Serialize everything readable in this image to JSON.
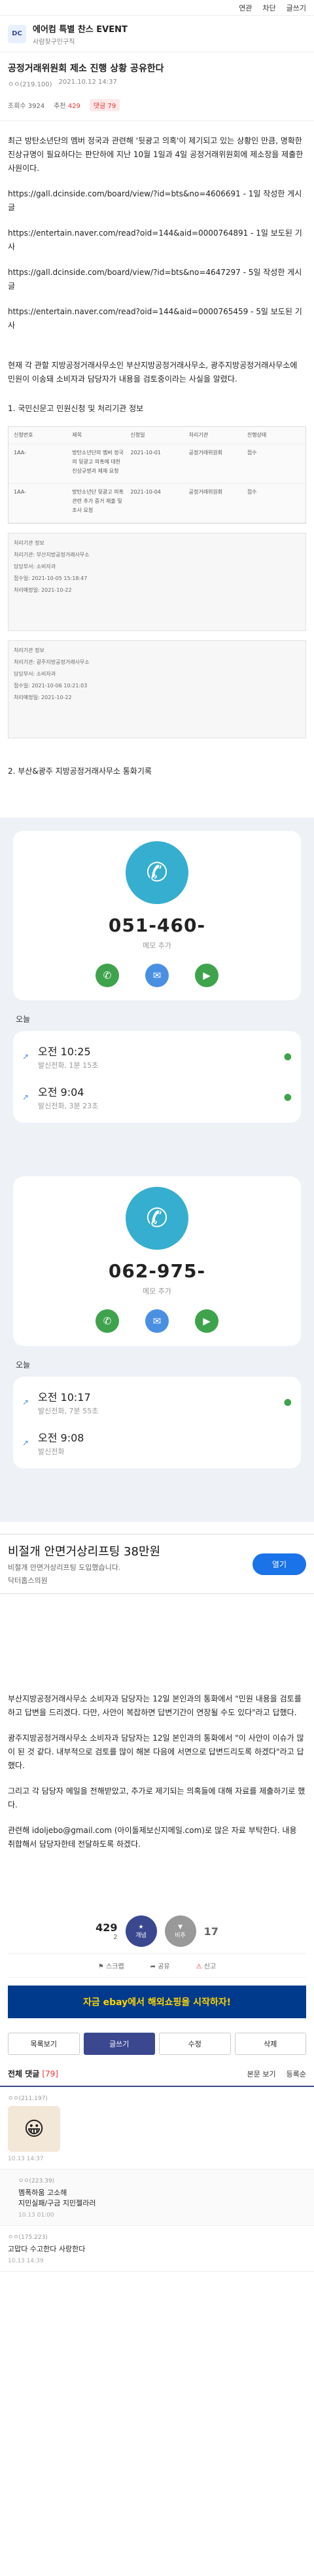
{
  "topbar": {
    "login": "연관",
    "top": "차단",
    "up": "글쓰기"
  },
  "board": {
    "title": "에어컴 특별 찬스 EVENT",
    "sub": "사람찾구인구직",
    "logo_text": "DC"
  },
  "post": {
    "title": "공정거래위원회 제소 진행 상황 공유한다",
    "author": "ㅇㅇ(219.100)",
    "date": "2021.10.12 14:37",
    "views": "조회수 3924",
    "likes_label": "추천",
    "likes": "429",
    "comments": "댓글 79"
  },
  "body": {
    "p1": "최근 방탄소년단의 멤버 정국과 관련해 '뒷광고 의혹'이 제기되고 있는 상황인 만큼, 명확한 진상규명이 필요하다는 판단하에 지난 10월 1일과 4일 공정거래위원회에 제소장을 제출한 사원이다.",
    "link1": "https://gall.dcinside.com/board/view/?id=bts&no=4606691 - 1일 작성한 게시글",
    "link2": "https://entertain.naver.com/read?oid=144&aid=0000764891 - 1일 보도된 기사",
    "link3": "https://gall.dcinside.com/board/view/?id=bts&no=4647297 - 5일 작성한 게시글",
    "link4": "https://entertain.naver.com/read?oid=144&aid=0000765459 - 5일 보도된 기사",
    "p2": "현재 각 관할 지방공정거래사무소인 부산지방공정거래사무소, 광주지방공정거래사무소에 민원이 이송돼 소비자과 담당자가 내용을 검토중이라는 사실을 알렸다.",
    "h1": "1. 국민신문고 민원신청 및 처리기관 정보",
    "h2": "2. 부산&광주 지방공정거래사무소 통화기록",
    "p3": "부산지방공정거래사무소 소비자과 담당자는 12일 본인과의 통화에서 \"민원 내용을 검토를 하고 답변을 드리겠다. 다만, 사안이 복잡하면 답변기간이 연장될 수도 있다\"라고 답했다.",
    "p4": "광주지방공정거래사무소 소비자과 담당자는 12일 본인과의 통화에서 \"이 사안이 이슈가 많이 된 것 같다. 내부적으로 검토를 많이 해본 다음에 서면으로 답변드리도록 하겠다\"라고 답했다.",
    "p5": "그리고 각 담당자 메일을 전해받았고, 추가로 제기되는 의혹들에 대해 자료를 제출하기로 했다.",
    "p6": "관련해 idoljebo@gmail.com (아이돌제보신지메일.com)로 많은 자료 부탁한다. 내용 취합해서 담당자한테 전달하도록 하겠다."
  },
  "doc": {
    "headers": [
      "신청번호",
      "제목",
      "신청일",
      "처리기관",
      "진행상태"
    ],
    "rows": [
      [
        "1AA-",
        "방탄소년단의 멤버 정국의 뒷광고 의혹에 대한 진상규명과 제재 요청",
        "2021-10-01",
        "공정거래위원회",
        "접수"
      ],
      [
        "1AA-",
        "방탄소년단 뒷광고 의혹 관련 추가 증거 제출 및 조사 요청",
        "2021-10-04",
        "공정거래위원회",
        "접수"
      ]
    ],
    "panel1": [
      "처리기관 정보",
      "처리기관: 부산지방공정거래사무소",
      "담당부서: 소비자과",
      "접수일: 2021-10-05 15:18:47",
      "처리예정일: 2021-10-22"
    ],
    "panel2": [
      "처리기관 정보",
      "처리기관: 광주지방공정거래사무소",
      "담당부서: 소비자과",
      "접수일: 2021-10-06 10:21:03",
      "처리예정일: 2021-10-22"
    ]
  },
  "calls": [
    {
      "number": "051-460-",
      "memo": "메모 추가",
      "today": "오늘",
      "logs": [
        {
          "time": "오전 10:25",
          "sub": "발신전화, 1분 15초"
        },
        {
          "time": "오전 9:04",
          "sub": "발신전화, 3분 23초"
        }
      ]
    },
    {
      "number": "062-975-",
      "memo": "메모 추가",
      "today": "오늘",
      "logs": [
        {
          "time": "오전 10:17",
          "sub": "발신전화, 7분 55초"
        },
        {
          "time": "오전 9:08",
          "sub": "발신전화"
        }
      ]
    }
  ],
  "ad": {
    "title": "비절개 안면거상리프팅 38만원",
    "sub": "비절개 안면거상리프팅 도입했습니다.",
    "sub2": "닥터홉스의원",
    "button": "열기"
  },
  "vote": {
    "up": "429",
    "up_sub": "2",
    "up_label": "개념",
    "down": "17",
    "down_label": "비추"
  },
  "share": {
    "scrap": "공유",
    "report": "신고",
    "bookmark": "스크랩"
  },
  "banner": {
    "text": "자금 ebay에서 해외쇼핑을 시작하자!"
  },
  "buttons": {
    "list": "목록보기",
    "write": "글쓰기",
    "edit": "수정",
    "delete": "삭제"
  },
  "comments_head": {
    "label": "전체 댓글",
    "count": "[79]",
    "sort1": "본문 보기",
    "sort2": "등록순"
  },
  "comments": [
    {
      "nick": "ㅇㅇ(211.197)",
      "date": "10.13 14:37",
      "emoji": true
    },
    {
      "nick": "ㅇㅇ(223.39)",
      "text": "멤폭하움 고소해\n지민실패/구금 지민젤라러",
      "date": "10.13 01:00",
      "reply": true
    },
    {
      "nick": "ㅇㅇ(175.223)",
      "text": "고맙다 수고한다 사랑한다",
      "date": "10.13 14:39"
    }
  ],
  "colors": {
    "accent": "#3b4890",
    "call_teal": "#36aecf",
    "call_green": "#3fa34d",
    "call_blue": "#4a90e2"
  }
}
